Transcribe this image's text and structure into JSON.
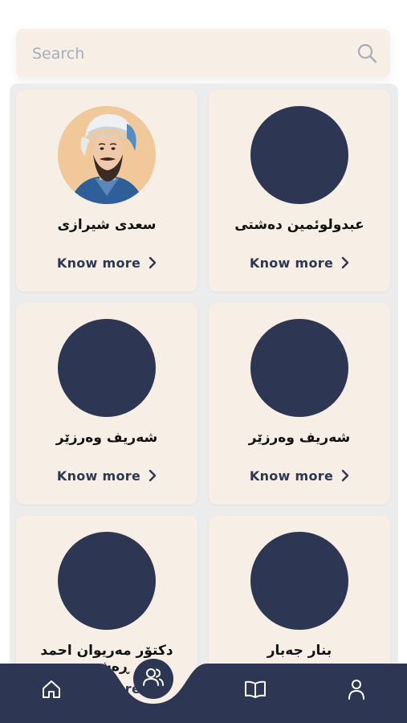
{
  "search": {
    "placeholder": "Search"
  },
  "know_more_label": "Know more",
  "poets": [
    {
      "name": "سعدی شیرازی",
      "has_photo": true
    },
    {
      "name": "عبدولوئمین دەشتی",
      "has_photo": false
    },
    {
      "name": "شەریف وەرزێر",
      "has_photo": false
    },
    {
      "name": "شەریف وەرزێر",
      "has_photo": false
    },
    {
      "name": "دکتۆر مەریوان احمد ڕەشید",
      "has_photo": false
    },
    {
      "name": "بنار جەبار",
      "has_photo": false
    }
  ],
  "nav": {
    "items": [
      "home-icon",
      "people-icon",
      "book-icon",
      "person-icon"
    ],
    "active": "people-icon"
  },
  "colors": {
    "navy": "#2d3753",
    "card": "#f7efe6",
    "background": "#ffffff"
  }
}
